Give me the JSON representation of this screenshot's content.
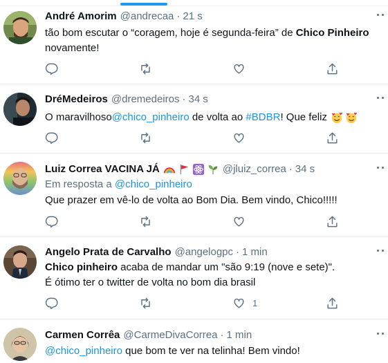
{
  "tweets": [
    {
      "name": "André Amorim",
      "handle": "@andrecaa",
      "time": "21 s",
      "text_parts": [
        "tão bom escutar o “coragem, hoje é segunda-feira” de ",
        "Chico Pinheiro",
        "novamente!"
      ],
      "like_count": ""
    },
    {
      "name": "DréMedeiros",
      "handle": "@dremedeiros",
      "time": "34 s",
      "text_parts": [
        "O maravilhoso ",
        "@chico_pinheiro",
        " de volta ao ",
        "#BDBR",
        "! Que feliz"
      ],
      "emojis": [
        "smiling-face-with-hearts-icon",
        "smiling-face-with-hearts-icon"
      ],
      "like_count": ""
    },
    {
      "name": "Luiz Correa VACINA JÁ",
      "handle": "@jluiz_correa",
      "time": "34 s",
      "name_emojis": [
        "rainbow-icon",
        "red-flag-icon",
        "atom-symbol-icon",
        "seedling-icon"
      ],
      "reply_label": "Em resposta a ",
      "reply_handle": "@chico_pinheiro",
      "text_parts": [
        "Que prazer em vê-lo de volta ao Bom Dia. Bem vindo, Chico!!!!!"
      ],
      "like_count": ""
    },
    {
      "name": "Angelo Prata de Carvalho",
      "handle": "@angelogpc",
      "time": "1 min",
      "text_parts": [
        "Chico pinheiro",
        " acaba de mandar um \"são 9:19 (nove e sete)\".",
        "É ótimo ter o twitter de volta no bom dia brasil"
      ],
      "like_count": "1"
    },
    {
      "name": "Carmen Corrêa",
      "handle": "@CarmeDivaCorrea",
      "time": "1 min",
      "text_parts": [
        "@chico_pinheiro",
        " que bom te ver na telinha! Bem vindo!"
      ],
      "like_count": ""
    }
  ],
  "colors": {
    "link": "#1b95e0",
    "secondary_text": "#5b7083",
    "divider": "#e6ecf0",
    "accent": "#1d9bf0"
  }
}
